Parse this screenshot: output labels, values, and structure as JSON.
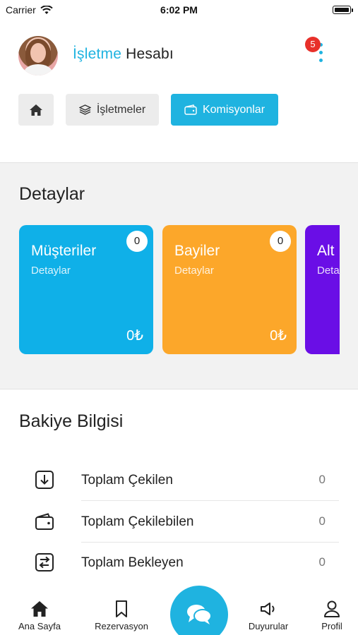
{
  "status_bar": {
    "carrier": "Carrier",
    "time": "6:02 PM"
  },
  "header": {
    "title_accent": "İşletme",
    "title_rest": "Hesabı",
    "notification_count": "5",
    "accent_color": "#1fb3e0",
    "badge_color": "#e8302a"
  },
  "top_buttons": {
    "home_icon": "home-icon",
    "isletmeler_label": "İşletmeler",
    "isletmeler_icon": "layers-icon",
    "komisyonlar_label": "Komisyonlar",
    "komisyonlar_icon": "wallet-icon"
  },
  "details": {
    "title": "Detaylar",
    "cards": [
      {
        "title": "Müşteriler",
        "subtitle": "Detaylar",
        "count": "0",
        "amount": "0₺",
        "color": "#0fb0e8"
      },
      {
        "title": "Bayiler",
        "subtitle": "Detaylar",
        "count": "0",
        "amount": "0₺",
        "color": "#fca72a"
      },
      {
        "title": "Alt",
        "subtitle": "Deta",
        "color": "#6a0ee6"
      }
    ]
  },
  "balance": {
    "title": "Bakiye Bilgisi",
    "rows": [
      {
        "label": "Toplam Çekilen",
        "value": "0",
        "icon": "download-icon"
      },
      {
        "label": "Toplam Çekilebilen",
        "value": "0",
        "icon": "wallet-icon"
      },
      {
        "label": "Toplam Bekleyen",
        "value": "0",
        "icon": "transfer-icon"
      }
    ]
  },
  "bottom_nav": {
    "items": [
      {
        "label": "Ana Sayfa",
        "icon": "home-icon"
      },
      {
        "label": "Rezervasyon",
        "icon": "bookmark-icon"
      },
      {
        "label": "Duyurular",
        "icon": "megaphone-icon"
      },
      {
        "label": "Profil",
        "icon": "user-icon"
      }
    ],
    "center_icon": "chat-icon"
  }
}
